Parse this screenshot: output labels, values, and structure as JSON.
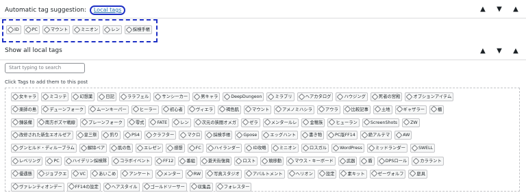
{
  "suggestion_panel": {
    "title": "Automatic tag suggestion:",
    "link": "Local tags",
    "tags": [
      "ID",
      "PC",
      "マウント",
      "ミニオン",
      "レン",
      "採検手帳"
    ]
  },
  "local_panel": {
    "title": "Show all local tags"
  },
  "search": {
    "placeholder": "Start typing to search"
  },
  "hint": "Click Tags to add them to this post",
  "controls": {
    "up": "▲",
    "down": "▼",
    "toggle": "▲"
  },
  "tag_rows": [
    [
      "女キャラ",
      "ミコッテ",
      "幻想薬",
      "日記",
      "ララフェル",
      "サンシーカー",
      "男キャラ",
      "DeepDungeon",
      "ミラプリ",
      "ヘアカタログ",
      "ハウジング",
      "死者の宮殿",
      "オプションアイテム"
    ],
    [
      "楽師の島",
      "デューンフォーク",
      "ムーンキーパー",
      "ヒーラー",
      "初心者",
      "ヴィエラ",
      "褐色肌",
      "マウント",
      "アメノミハシラ",
      "アウラ",
      "比較記事",
      "土地",
      "ギャザラー",
      "櫃"
    ],
    [
      "錬装備",
      "南方ボズヤ戦線",
      "プレーンフォーク",
      "零式",
      "FATE",
      "レン",
      "次元の狭間オメガ",
      "ゼラ",
      "メンタールレ",
      "金穂族",
      "ヒューラン",
      "ScreenShots",
      "ZW"
    ],
    [
      "改修された新生エオルゼア",
      "皇三祭",
      "釣り",
      "PS4",
      "クラフター",
      "マクロ",
      "採検手帳",
      "Gpose",
      "エッグハント",
      "書き物",
      "PC版FF14",
      "絶アルテマ",
      "AW"
    ],
    [
      "グンヒルド・ディルーブラム",
      "解除ペア",
      "肌の色",
      "エレゼン",
      "感想",
      "FC",
      "ハイランダー",
      "ID攻略",
      "ミニオン",
      "ロスガル",
      "WordPress",
      "ミッドランダー",
      "SWELL"
    ],
    [
      "レベリング",
      "PC",
      "ハイデリン採検隊",
      "コラボイベント",
      "FF12",
      "番組",
      "蒼天街復興",
      "ロスト",
      "競移動",
      "マウス・キーボード",
      "武器",
      "盾",
      "DPSロール",
      "カララント"
    ],
    [
      "優遇態",
      "ジョブクエ",
      "VC",
      "あいこめ",
      "アンケート",
      "メンター",
      "RW",
      "写真スタジオ",
      "アバルトメント",
      "ヘリオン",
      "設定",
      "素キット",
      "ゼーヴォルフ",
      "庭具"
    ],
    [
      "ヴァレンティオンデー",
      "FF14の設定",
      "ヘアスタイル",
      "ゴールドソーサー",
      "収集品",
      "フォレスター"
    ]
  ]
}
